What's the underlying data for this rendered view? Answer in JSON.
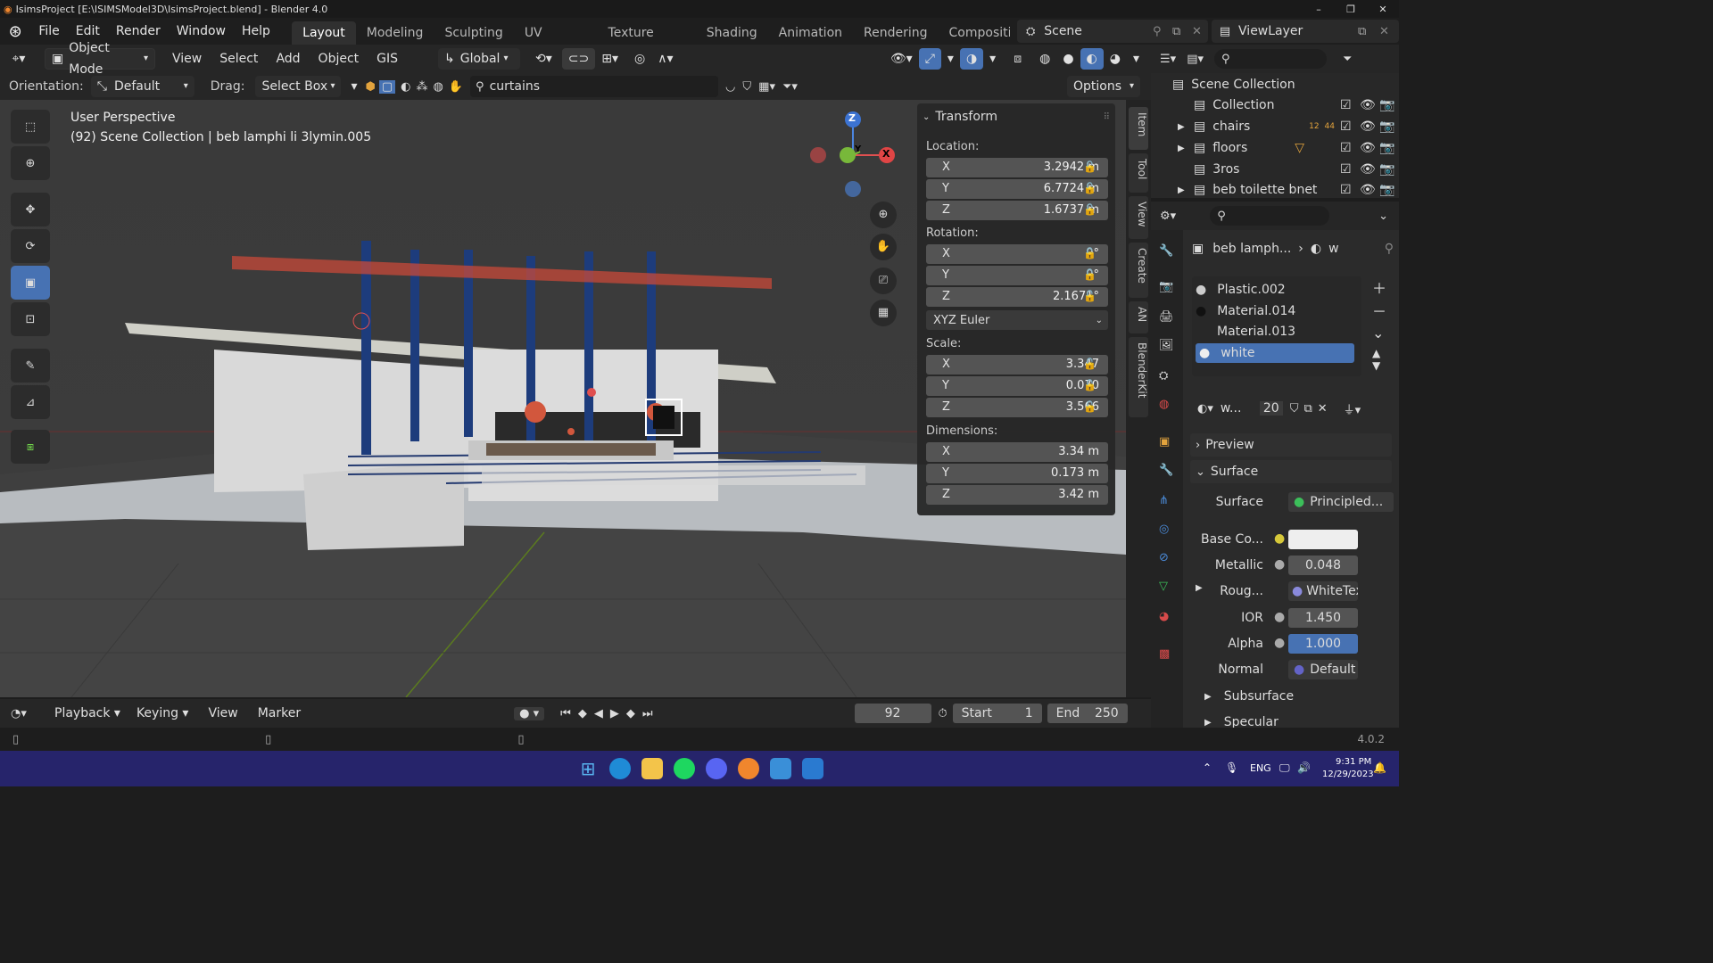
{
  "titlebar": {
    "title": "IsimsProject [E:\\ISIMSModel3D\\IsimsProject.blend] - Blender 4.0",
    "min": "–",
    "max": "❐",
    "close": "✕"
  },
  "menu": {
    "items": [
      "File",
      "Edit",
      "Render",
      "Window",
      "Help"
    ]
  },
  "workspaces": {
    "tabs": [
      "Layout",
      "Modeling",
      "Sculpting",
      "UV Editing",
      "Texture Paint",
      "Shading",
      "Animation",
      "Rendering",
      "Compositin"
    ],
    "active": "Layout",
    "scene": "Scene",
    "viewlayer": "ViewLayer"
  },
  "header": {
    "mode": "Object Mode",
    "view": "View",
    "select": "Select",
    "add": "Add",
    "object": "Object",
    "gis": "GIS",
    "transform_orientation": "Global"
  },
  "tool_settings": {
    "orientation_label": "Orientation:",
    "orientation_value": "Default",
    "drag_label": "Drag:",
    "drag_value": "Select Box",
    "search_value": "curtains",
    "options": "Options"
  },
  "viewport": {
    "perspective": "User Perspective",
    "context": "(92) Scene Collection | beb lamphi li 3lymin.005",
    "gizmo_x": "X",
    "gizmo_y": "Y",
    "gizmo_z": "Z"
  },
  "transform": {
    "title": "Transform",
    "location_label": "Location:",
    "location": [
      {
        "axis": "X",
        "value": "3.2942 m"
      },
      {
        "axis": "Y",
        "value": "6.7724 m"
      },
      {
        "axis": "Z",
        "value": "1.6737 m"
      }
    ],
    "rotation_label": "Rotation:",
    "rotation": [
      {
        "axis": "X",
        "value": "0°"
      },
      {
        "axis": "Y",
        "value": "0°"
      },
      {
        "axis": "Z",
        "value": "2.1671°"
      }
    ],
    "rotation_mode": "XYZ Euler",
    "scale_label": "Scale:",
    "scale": [
      {
        "axis": "X",
        "value": "3.347"
      },
      {
        "axis": "Y",
        "value": "0.070"
      },
      {
        "axis": "Z",
        "value": "3.566"
      }
    ],
    "dimensions_label": "Dimensions:",
    "dimensions": [
      {
        "axis": "X",
        "value": "3.34 m"
      },
      {
        "axis": "Y",
        "value": "0.173 m"
      },
      {
        "axis": "Z",
        "value": "3.42 m"
      }
    ]
  },
  "side_tabs": [
    "Item",
    "Tool",
    "View",
    "Create",
    "AN",
    "BlenderKit"
  ],
  "outliner": {
    "root": "Scene Collection",
    "items": [
      {
        "name": "Collection",
        "badge": ""
      },
      {
        "name": "chairs",
        "badge": "12"
      },
      {
        "name": "floors",
        "badge": ""
      },
      {
        "name": "3ros",
        "badge": ""
      },
      {
        "name": "beb toilette bnet",
        "badge": ""
      }
    ],
    "chairs_badge2": "44"
  },
  "properties": {
    "breadcrumb_object": "beb lamph...",
    "breadcrumb_mat": "w",
    "materials": [
      "Plastic.002",
      "Material.014",
      "Material.013",
      "white"
    ],
    "active_material": "white",
    "mat_name": "w...",
    "mat_users": "20",
    "preview": "Preview",
    "surface_section": "Surface",
    "surface_label": "Surface",
    "surface_value": "Principled...",
    "base_color_label": "Base Co...",
    "metallic_label": "Metallic",
    "metallic_value": "0.048",
    "roughness_label": "Roug...",
    "roughness_value": "WhiteText...",
    "ior_label": "IOR",
    "ior_value": "1.450",
    "alpha_label": "Alpha",
    "alpha_value": "1.000",
    "normal_label": "Normal",
    "normal_value": "Default",
    "subsurface": "Subsurface",
    "specular": "Specular"
  },
  "timeline": {
    "playback": "Playback",
    "keying": "Keying",
    "view": "View",
    "marker": "Marker",
    "frame": "92",
    "start_label": "Start",
    "start": "1",
    "end_label": "End",
    "end": "250"
  },
  "status": {
    "version": "4.0.2"
  },
  "taskbar": {
    "lang": "ENG",
    "time": "9:31 PM",
    "date": "12/29/2023"
  },
  "colors": {
    "accent": "#4772b3",
    "bg": "#1d1d1d",
    "taskbar": "#26246b"
  }
}
